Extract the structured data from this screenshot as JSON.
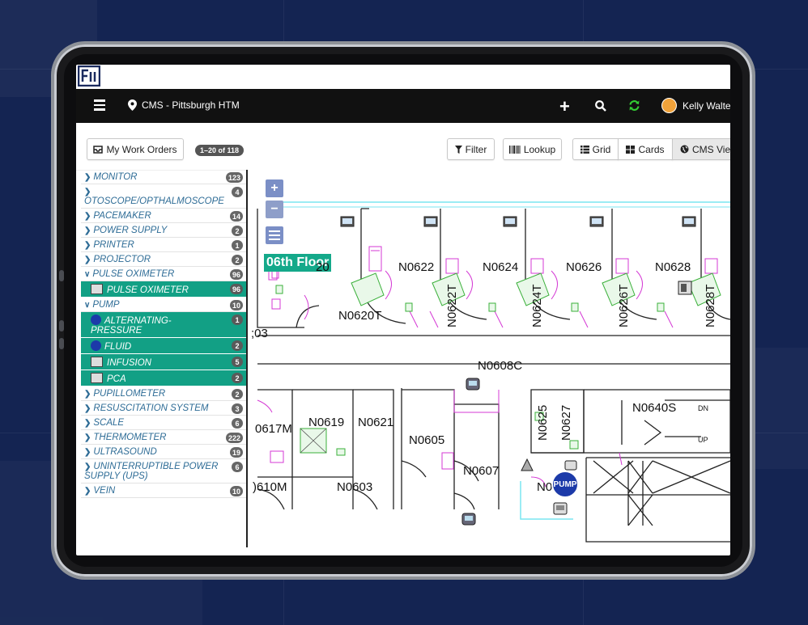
{
  "app": {
    "location": "CMS - Pittsburgh HTM",
    "user_name": "Kelly Walte"
  },
  "toolbar": {
    "my_work_orders": "My Work Orders",
    "range_badge": "1–20 of 118",
    "filter": "Filter",
    "lookup": "Lookup",
    "grid": "Grid",
    "cards": "Cards",
    "cms_view": "CMS Vie"
  },
  "sidebar": {
    "items": [
      {
        "label": "MONITOR",
        "count": "123",
        "type": "collapsed"
      },
      {
        "label": "OTOSCOPE/OPTHALMOSCOPE",
        "count": "4",
        "type": "collapsed"
      },
      {
        "label": "PACEMAKER",
        "count": "14",
        "type": "collapsed"
      },
      {
        "label": "POWER SUPPLY",
        "count": "2",
        "type": "collapsed"
      },
      {
        "label": "PRINTER",
        "count": "1",
        "type": "collapsed"
      },
      {
        "label": "PROJECTOR",
        "count": "2",
        "type": "collapsed"
      },
      {
        "label": "PULSE OXIMETER",
        "count": "96",
        "type": "expanded"
      },
      {
        "label": "PULSE OXIMETER",
        "count": "96",
        "type": "selected",
        "icon": "pulse-oximeter-device-icon"
      },
      {
        "label": "PUMP",
        "count": "10",
        "type": "expanded"
      },
      {
        "label": "ALTERNATING-PRESSURE",
        "count": "1",
        "type": "selected",
        "icon": "pump-icon"
      },
      {
        "label": "FLUID",
        "count": "2",
        "type": "selected",
        "icon": "pump-icon"
      },
      {
        "label": "INFUSION",
        "count": "5",
        "type": "selected",
        "icon": "infusion-device-icon"
      },
      {
        "label": "PCA",
        "count": "2",
        "type": "selected",
        "icon": "pca-device-icon"
      },
      {
        "label": "PUPILLOMETER",
        "count": "2",
        "type": "collapsed"
      },
      {
        "label": "RESUSCITATION SYSTEM",
        "count": "3",
        "type": "collapsed"
      },
      {
        "label": "SCALE",
        "count": "6",
        "type": "collapsed"
      },
      {
        "label": "THERMOMETER",
        "count": "222",
        "type": "collapsed"
      },
      {
        "label": "ULTRASOUND",
        "count": "19",
        "type": "collapsed"
      },
      {
        "label": "UNINTERRUPTIBLE POWER SUPPLY (UPS)",
        "count": "6",
        "type": "collapsed"
      },
      {
        "label": "VEIN",
        "count": "10",
        "type": "collapsed"
      }
    ]
  },
  "map": {
    "floor_label": "06th Floor",
    "zoom_in": "+",
    "zoom_out": "−",
    "pump_badge": "PUMP",
    "rooms": {
      "n0620": "20",
      "n0620t": "N0620T",
      "n0622": "N0622",
      "n0622t": "N0622T",
      "n0624": "N0624",
      "n0624t": "N0624T",
      "n0626": "N0626",
      "n0626t": "N0626T",
      "n0628": "N0628",
      "n0628t": "N0628T",
      "n0603x": ";03",
      "n0608c": "N0608C",
      "n0617m": "0617M",
      "n0619": "N0619",
      "n0621": "N0621",
      "n0605": "N0605",
      "n0607": "N0607",
      "n0625": "N0625",
      "n0627": "N0627",
      "n0640s": "N0640S",
      "dn": "DN",
      "up": "UP",
      "n0610m": ")610M",
      "n0603": "N0603",
      "n0609": "N0"
    }
  },
  "colors": {
    "accent": "#12a085",
    "nav_bg": "#111111",
    "pump_blue": "#1c3aa9",
    "refresh_green": "#33cc33",
    "zoom_btn": "#7b8fc6"
  }
}
